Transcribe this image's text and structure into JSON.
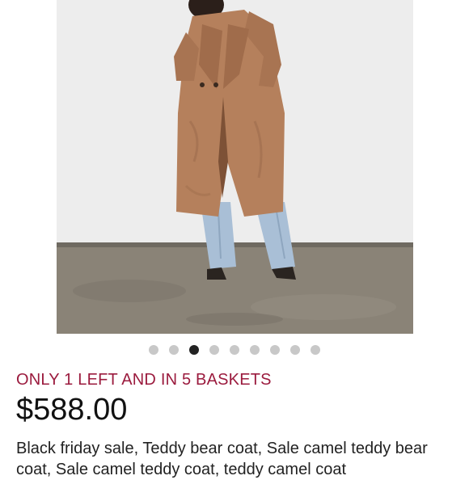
{
  "listing": {
    "stock_message": "ONLY 1 LEFT AND IN 5 BASKETS",
    "price": "$588.00",
    "description": "Black friday sale, Teddy bear coat, Sale camel teddy bear coat, Sale camel teddy coat, teddy camel coat"
  },
  "carousel": {
    "total_images": 9,
    "active_index": 2
  },
  "colors": {
    "stock_message": "#9b1b3e",
    "active_dot": "#222222",
    "inactive_dot": "#c8c8c8",
    "coat": "#b5805c"
  }
}
